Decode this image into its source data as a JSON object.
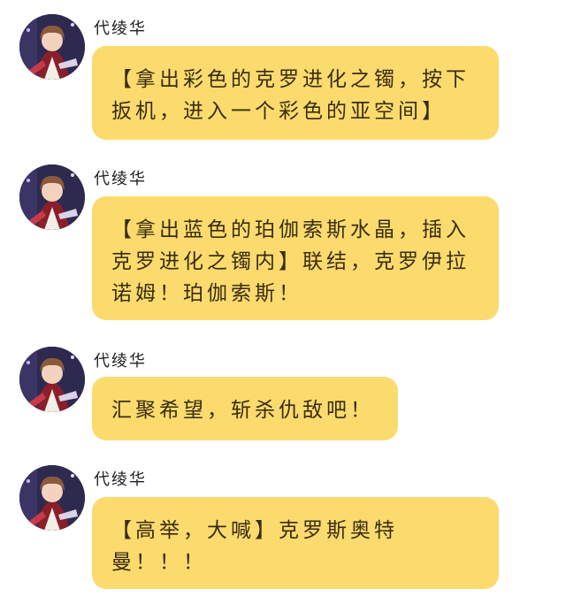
{
  "chat": {
    "messages": [
      {
        "sender": "代绫华",
        "text": "【拿出彩色的克罗进化之镯，按下扳机，进入一个彩色的亚空间】"
      },
      {
        "sender": "代绫华",
        "text": "【拿出蓝色的珀伽索斯水晶，插入克罗进化之镯内】联结，克罗伊拉诺姆！珀伽索斯！"
      },
      {
        "sender": "代绫华",
        "text": "汇聚希望，斩杀仇敌吧！"
      },
      {
        "sender": "代绫华",
        "text": "【高举，大喊】克罗斯奥特曼！！！"
      }
    ]
  },
  "colors": {
    "bubble": "#fbdb6e",
    "text": "#3a2c12",
    "background": "#ffffff"
  },
  "icons": {
    "avatar": "anime-character-avatar"
  }
}
